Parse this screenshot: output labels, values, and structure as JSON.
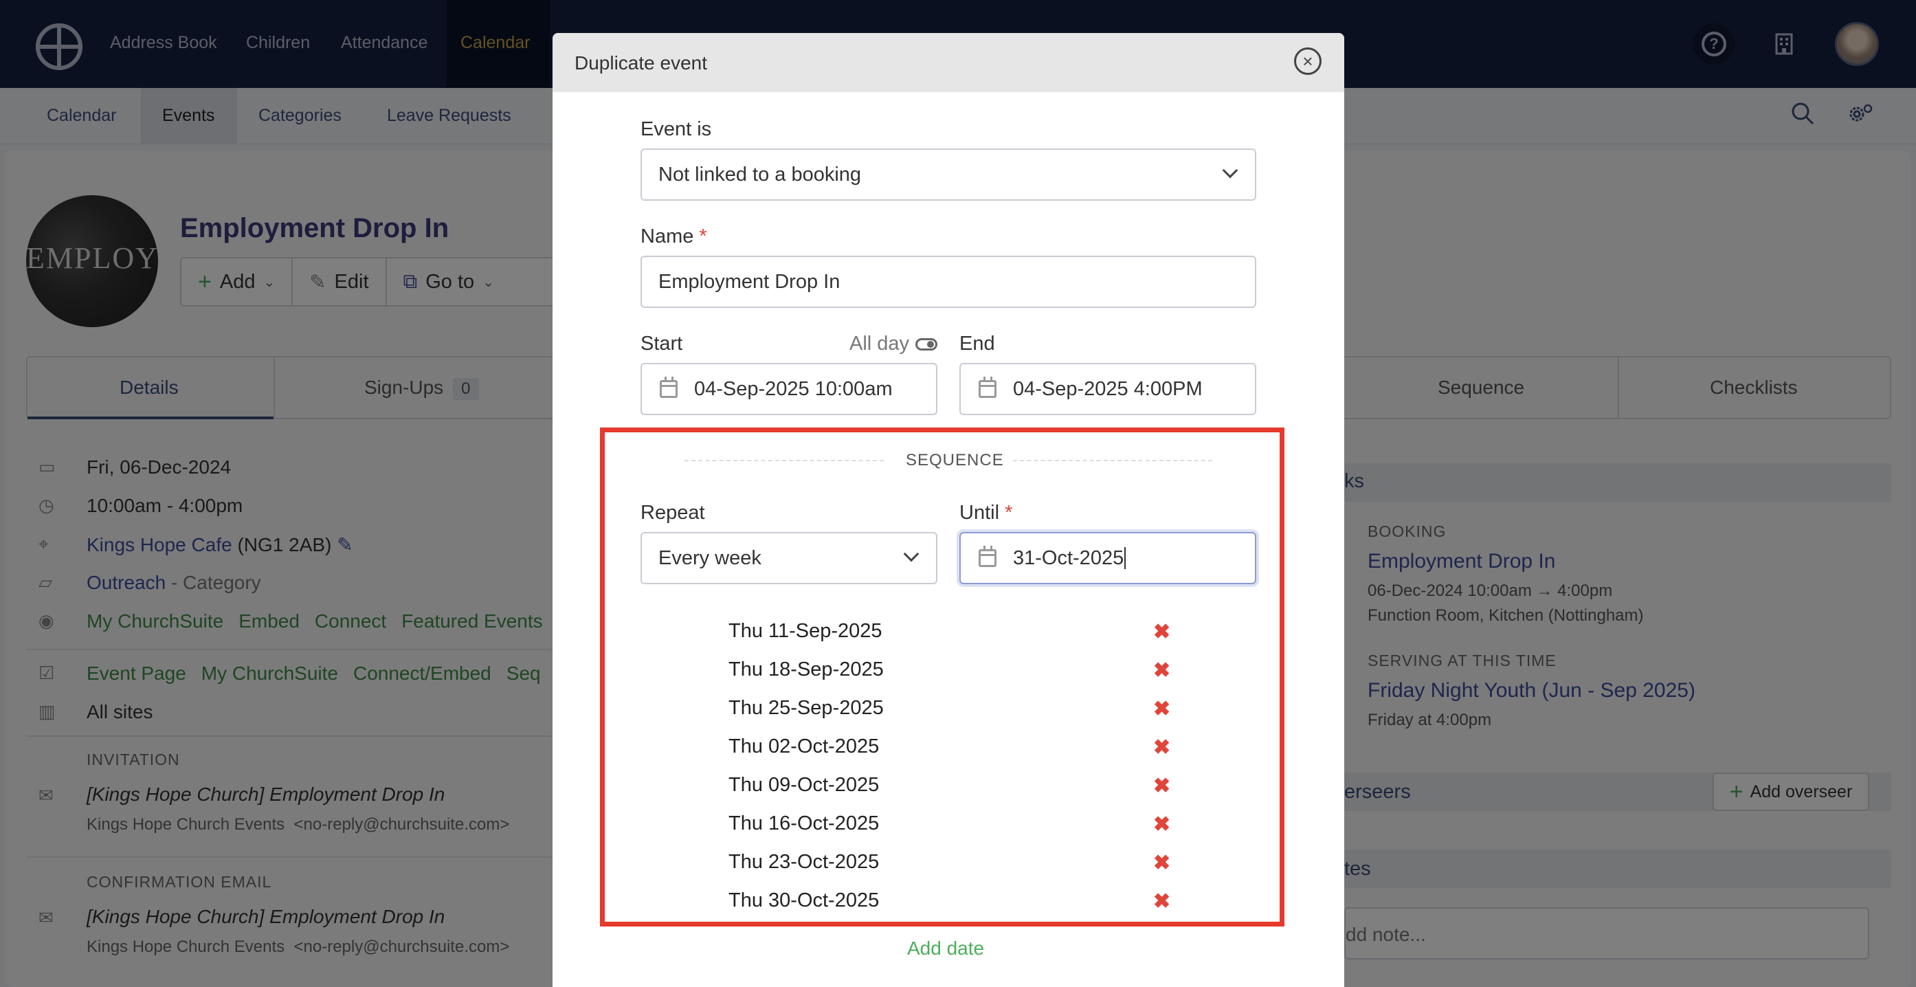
{
  "topnav": {
    "items": [
      "Address Book",
      "Children",
      "Attendance",
      "Calendar"
    ],
    "active": "Calendar"
  },
  "subnav": {
    "items": [
      "Calendar",
      "Events",
      "Categories",
      "Leave Requests"
    ],
    "active": "Events"
  },
  "event": {
    "title": "Employment Drop In",
    "image_text": "EMPLOYE",
    "buttons": {
      "add": "Add",
      "edit": "Edit",
      "goto": "Go to"
    },
    "tabs": [
      {
        "label": "Details"
      },
      {
        "label": "Sign-Ups",
        "badge": "0"
      },
      {
        "label": "Sequence"
      },
      {
        "label": "Checklists"
      }
    ],
    "details": {
      "date": "Fri, 06-Dec-2024",
      "time": "10:00am - 4:00pm",
      "location_link": "Kings Hope Cafe",
      "location_postcode": "(NG1 2AB)",
      "category_link": "Outreach",
      "category_suffix": "- Category",
      "visibility": [
        "My ChurchSuite",
        "Embed",
        "Connect",
        "Featured Events"
      ],
      "enabled": [
        "Event Page",
        "My ChurchSuite",
        "Connect/Embed",
        "Seq"
      ],
      "sites": "All sites"
    },
    "invitation": {
      "label": "INVITATION",
      "subject": "[Kings Hope Church] Employment Drop In",
      "from": "Kings Hope Church Events",
      "from_email": "<no-reply@churchsuite.com>"
    },
    "confirmation": {
      "label": "CONFIRMATION EMAIL",
      "subject": "[Kings Hope Church] Employment Drop In",
      "from": "Kings Hope Church Events",
      "from_email": "<no-reply@churchsuite.com>"
    }
  },
  "right_panel": {
    "links_header": "ks",
    "booking_label": "BOOKING",
    "booking_name": "Employment Drop In",
    "booking_time": "06-Dec-2024 10:00am → 4:00pm",
    "booking_rooms": "Function Room, Kitchen (Nottingham)",
    "serving_label": "SERVING AT THIS TIME",
    "serving_name": "Friday Night Youth (Jun - Sep 2025)",
    "serving_time": "Friday at 4:00pm",
    "overseers_header": "erseers",
    "add_overseer": "Add overseer",
    "notes_header": "tes",
    "note_placeholder": "dd note..."
  },
  "modal": {
    "title": "Duplicate event",
    "event_is_label": "Event is",
    "event_is_value": "Not linked to a booking",
    "name_label": "Name",
    "name_value": "Employment Drop In",
    "start_label": "Start",
    "all_day_label": "All day",
    "end_label": "End",
    "start_value": "04-Sep-2025 10:00am",
    "end_value": "04-Sep-2025 4:00PM",
    "sequence_title": "SEQUENCE",
    "repeat_label": "Repeat",
    "repeat_value": "Every week",
    "until_label": "Until",
    "until_value": "31-Oct-2025",
    "dates": [
      "Thu 11-Sep-2025",
      "Thu 18-Sep-2025",
      "Thu 25-Sep-2025",
      "Thu 02-Oct-2025",
      "Thu 09-Oct-2025",
      "Thu 16-Oct-2025",
      "Thu 23-Oct-2025",
      "Thu 30-Oct-2025"
    ],
    "remove_mark": "✖",
    "add_date": "Add date"
  },
  "colors": {
    "nav_bg": "#142040",
    "accent_gold": "#c8a44a",
    "highlight_red": "#e63a2c",
    "success_green": "#4cae5a",
    "required_red": "#e0453a"
  },
  "icons": [
    "logo-icon",
    "help-icon",
    "building-icon",
    "search-icon",
    "settings-icon",
    "close-icon",
    "calendar-icon",
    "clock-icon",
    "pin-icon",
    "folder-icon",
    "eye-icon",
    "checkbox-icon",
    "mail-icon",
    "pencil-icon",
    "external-link-icon",
    "chevron-down-icon"
  ]
}
